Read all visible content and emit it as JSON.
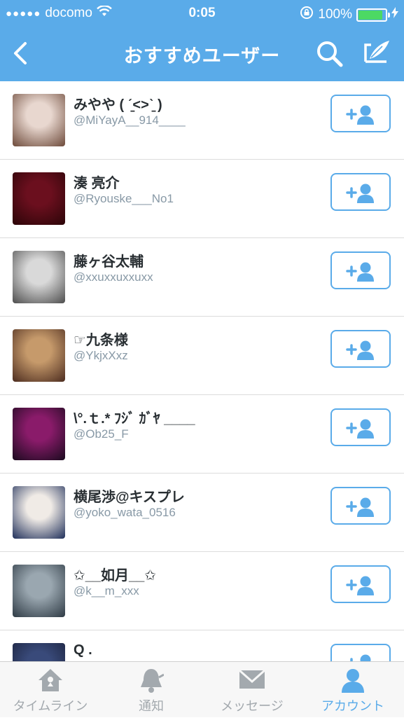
{
  "status_bar": {
    "signal": "●●●●●",
    "carrier": "docomo",
    "time": "0:05",
    "battery": "100%"
  },
  "nav": {
    "title": "おすすめユーザー"
  },
  "users": [
    {
      "name": "みやや ( ˊ̱˂˃ˋ̱ )",
      "handle": "@MiYayA__914____",
      "avatar_colors": [
        "#e8d7cf",
        "#6d4a3a"
      ]
    },
    {
      "name": "湊 亮介",
      "handle": "@Ryouske___No1",
      "avatar_colors": [
        "#6b0f1e",
        "#2b0508"
      ]
    },
    {
      "name": "藤ヶ谷太輔",
      "handle": "@xxuxxuxxuxx",
      "avatar_colors": [
        "#d9d9d9",
        "#4d4d4d"
      ]
    },
    {
      "name": "☞九条様",
      "handle": "@YkjxXxz",
      "avatar_colors": [
        "#c69a6b",
        "#4c2c1f"
      ]
    },
    {
      "name": "\\°.ｔ.* ﾌｼﾞ ｶﾞﾔ ____",
      "handle": "@Ob25_F",
      "avatar_colors": [
        "#8a1b6a",
        "#1a0a1e"
      ]
    },
    {
      "name": "横尾渉@キスプレ",
      "handle": "@yoko_wata_0516",
      "avatar_colors": [
        "#f0ebe6",
        "#1f2f5a"
      ]
    },
    {
      "name": "✩__如月__✩",
      "handle": "@k__m_xxx",
      "avatar_colors": [
        "#9aa7b0",
        "#2e3a44"
      ]
    },
    {
      "name": "Q  .",
      "handle": "",
      "avatar_colors": [
        "#394a7a",
        "#1a213a"
      ]
    }
  ],
  "tabs": [
    {
      "label": "タイムライン",
      "icon": "home-icon",
      "active": false
    },
    {
      "label": "通知",
      "icon": "bell-icon",
      "active": false
    },
    {
      "label": "メッセージ",
      "icon": "envelope-icon",
      "active": false
    },
    {
      "label": "アカウント",
      "icon": "person-icon",
      "active": true
    }
  ],
  "colors": {
    "accent": "#5aabe9",
    "battery": "#4cd964",
    "tab_inactive": "#a3a9ae"
  }
}
